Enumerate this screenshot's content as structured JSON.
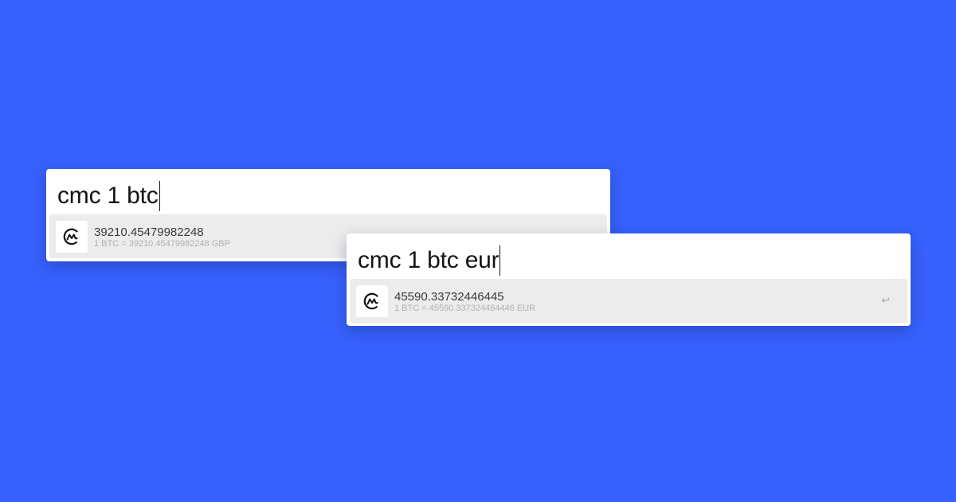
{
  "launchers": [
    {
      "query": "cmc 1 btc",
      "result": {
        "icon": "coinmarketcap-logo-icon",
        "title": "39210.45479982248",
        "subtitle": "1 BTC = 39210.45479982248 GBP"
      }
    },
    {
      "query": "cmc 1 btc eur",
      "result": {
        "icon": "coinmarketcap-logo-icon",
        "title": "45590.33732446445",
        "subtitle": "1 BTC = 45590.337324464446 EUR",
        "enter_hint": "↩"
      }
    }
  ],
  "colors": {
    "background": "#3761FC",
    "row_highlight": "#ECECEC"
  }
}
